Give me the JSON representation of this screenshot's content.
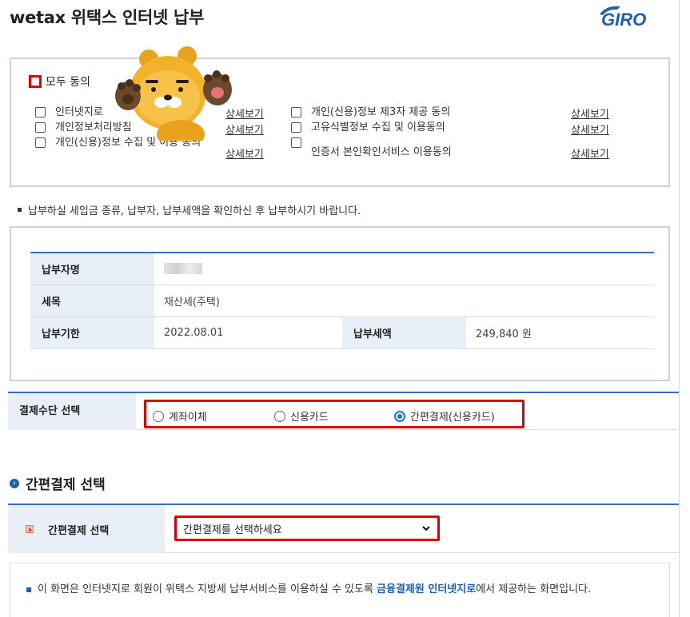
{
  "header": {
    "title": "wetax 위택스 인터넷 납부",
    "logo_text": "GIRO"
  },
  "agreement": {
    "all_agree_label": "모두 동의",
    "items": [
      {
        "label": "인터넷지로",
        "detail": "상세보기"
      },
      {
        "label": "개인정보처리방침",
        "detail": "상세보기"
      },
      {
        "label": "개인(신용)정보 수집 및 이용 동의",
        "detail": "상세보기"
      },
      {
        "label": "개인(신용)정보 제3자 제공 동의",
        "detail": "상세보기"
      },
      {
        "label": "고유식별정보 수집 및 이용동의",
        "detail": "상세보기"
      },
      {
        "label": "인증서 본인확인서비스 이용동의",
        "detail": "상세보기"
      }
    ]
  },
  "notice": "납부하실 세입금 종류, 납부자, 납부세액을 확인하신 후 납부하시기 바랍니다.",
  "payment_info": {
    "payer_label": "납부자명",
    "tax_item_label": "세목",
    "tax_item_value": "재산세(주택)",
    "due_date_label": "납부기한",
    "due_date_value": "2022.08.01",
    "amount_label": "납부세액",
    "amount_value": "249,840 원"
  },
  "payment_method": {
    "label": "결제수단 선택",
    "options": [
      "계좌이체",
      "신용카드",
      "간편결제(신용카드)"
    ],
    "selected_index": 2
  },
  "quick_pay": {
    "section_title": "간편결제 선택",
    "row_label": "간편결제 선택",
    "select_value": "간편결제를 선택하세요"
  },
  "bottom_notice": {
    "text_before": "이 화면은 인터넷지로 회원이 위택스 지방세 납부서비스를 이용하실 수 있도록 ",
    "highlight": "금융결제원 인터넷지로",
    "text_after": "에서 제공하는 화면입니다."
  },
  "colors": {
    "accent_blue": "#3a6cc1",
    "highlight_red": "#e00000",
    "header_cell_bg": "#e9eff7"
  }
}
